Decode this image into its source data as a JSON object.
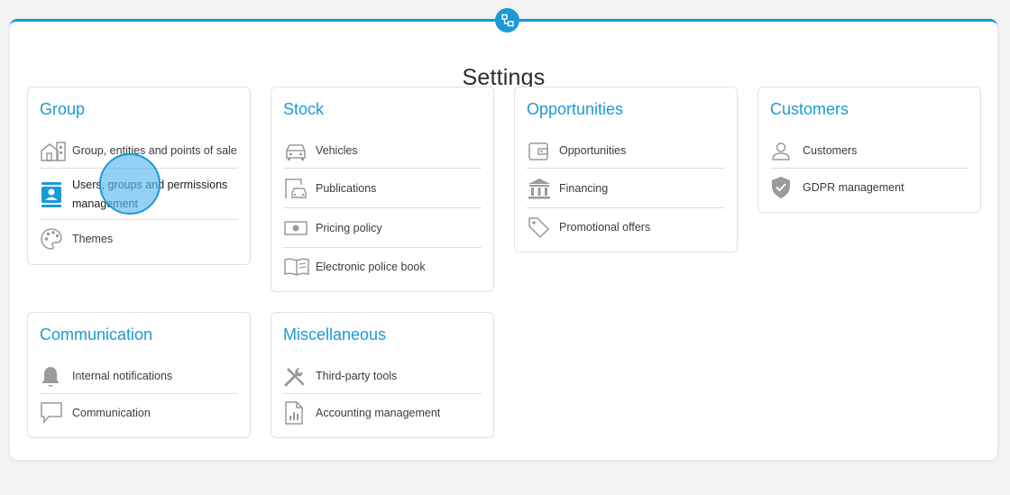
{
  "page": {
    "title": "Settings"
  },
  "accent_color": "#1a9ad6",
  "top_badge_icon": "network-icon",
  "cards": {
    "group": {
      "title": "Group",
      "items": [
        {
          "label": "Group, entities and points of sale",
          "icon": "building-icon"
        },
        {
          "label": "Users, groups and permissions management",
          "icon": "contacts-book-icon",
          "active": true
        },
        {
          "label": "Themes",
          "icon": "palette-icon"
        }
      ]
    },
    "stock": {
      "title": "Stock",
      "items": [
        {
          "label": "Vehicles",
          "icon": "car-icon"
        },
        {
          "label": "Publications",
          "icon": "car-showroom-icon"
        },
        {
          "label": "Pricing policy",
          "icon": "banknote-icon"
        },
        {
          "label": "Electronic police book",
          "icon": "open-book-icon"
        }
      ]
    },
    "opportunities": {
      "title": "Opportunities",
      "items": [
        {
          "label": "Opportunities",
          "icon": "wallet-icon"
        },
        {
          "label": "Financing",
          "icon": "bank-icon"
        },
        {
          "label": "Promotional offers",
          "icon": "tag-icon"
        }
      ]
    },
    "customers": {
      "title": "Customers",
      "items": [
        {
          "label": "Customers",
          "icon": "person-icon"
        },
        {
          "label": "GDPR management",
          "icon": "shield-check-icon"
        }
      ]
    },
    "communication": {
      "title": "Communication",
      "items": [
        {
          "label": "Internal notifications",
          "icon": "bell-icon"
        },
        {
          "label": "Communication",
          "icon": "speech-bubble-icon"
        }
      ]
    },
    "misc": {
      "title": "Miscellaneous",
      "items": [
        {
          "label": "Third-party tools",
          "icon": "tools-icon"
        },
        {
          "label": "Accounting management",
          "icon": "report-chart-icon"
        }
      ]
    }
  }
}
